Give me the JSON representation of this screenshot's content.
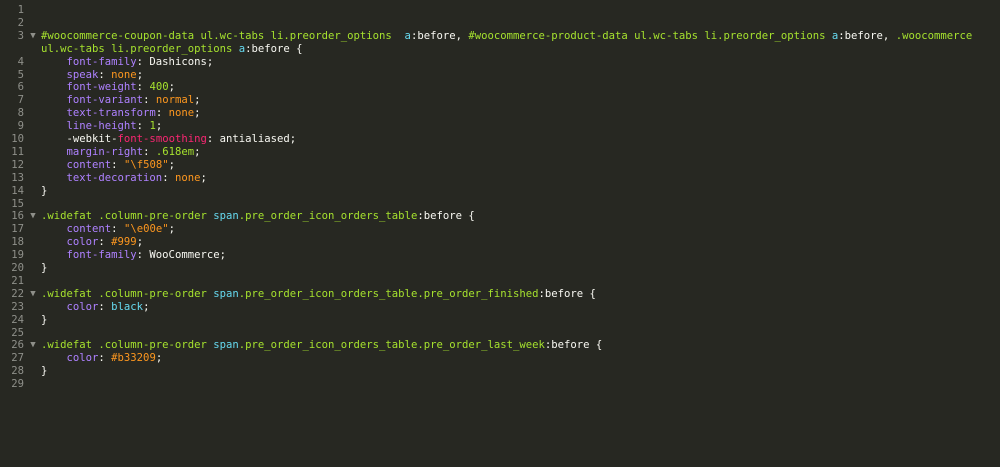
{
  "editor": {
    "language": "css",
    "colors": {
      "background": "#272822",
      "gutter_text": "#8f908a",
      "selector": "#a6e22e",
      "property": "#66d9ef",
      "value": "#e6db74",
      "number": "#ae81ff",
      "keyword": "#fd971f",
      "accent": "#f92672"
    },
    "lines": [
      {
        "n": "1",
        "fold": "",
        "tokens": []
      },
      {
        "n": "2",
        "fold": "",
        "tokens": []
      },
      {
        "n": "3",
        "fold": "▼",
        "tokens": [
          {
            "t": "#woocommerce-coupon-data ul.wc-tabs li.preorder_options  ",
            "c": "green"
          },
          {
            "t": "a",
            "c": "blue"
          },
          {
            "t": ":before, ",
            "c": "white"
          },
          {
            "t": "#woocommerce-product-data ul.wc-tabs li.preorder_options ",
            "c": "green"
          },
          {
            "t": "a",
            "c": "blue"
          },
          {
            "t": ":before, ",
            "c": "white"
          },
          {
            "t": ".woocommerce",
            "c": "green"
          }
        ]
      },
      {
        "n": "",
        "fold": "",
        "tokens": [
          {
            "t": "ul.wc-tabs li.preorder_options ",
            "c": "green"
          },
          {
            "t": "a",
            "c": "blue"
          },
          {
            "t": ":before {",
            "c": "white"
          }
        ]
      },
      {
        "n": "4",
        "fold": "",
        "tokens": [
          {
            "t": "    font-family",
            "c": "purple"
          },
          {
            "t": ": Dashicons;",
            "c": "white"
          }
        ]
      },
      {
        "n": "5",
        "fold": "",
        "tokens": [
          {
            "t": "    speak",
            "c": "purple"
          },
          {
            "t": ": ",
            "c": "white"
          },
          {
            "t": "none",
            "c": "orange"
          },
          {
            "t": ";",
            "c": "white"
          }
        ]
      },
      {
        "n": "6",
        "fold": "",
        "tokens": [
          {
            "t": "    font-weight",
            "c": "purple"
          },
          {
            "t": ": ",
            "c": "white"
          },
          {
            "t": "400",
            "c": "green"
          },
          {
            "t": ";",
            "c": "white"
          }
        ]
      },
      {
        "n": "7",
        "fold": "",
        "tokens": [
          {
            "t": "    font-variant",
            "c": "purple"
          },
          {
            "t": ": ",
            "c": "white"
          },
          {
            "t": "normal",
            "c": "orange"
          },
          {
            "t": ";",
            "c": "white"
          }
        ]
      },
      {
        "n": "8",
        "fold": "",
        "tokens": [
          {
            "t": "    text-transform",
            "c": "purple"
          },
          {
            "t": ": ",
            "c": "white"
          },
          {
            "t": "none",
            "c": "orange"
          },
          {
            "t": ";",
            "c": "white"
          }
        ]
      },
      {
        "n": "9",
        "fold": "",
        "tokens": [
          {
            "t": "    line-height",
            "c": "purple"
          },
          {
            "t": ": ",
            "c": "white"
          },
          {
            "t": "1",
            "c": "green"
          },
          {
            "t": ";",
            "c": "white"
          }
        ]
      },
      {
        "n": "10",
        "fold": "",
        "tokens": [
          {
            "t": "    -webkit-",
            "c": "white"
          },
          {
            "t": "font-smoothing",
            "c": "red"
          },
          {
            "t": ": antialiased;",
            "c": "white"
          }
        ]
      },
      {
        "n": "11",
        "fold": "",
        "tokens": [
          {
            "t": "    margin-right",
            "c": "purple"
          },
          {
            "t": ": ",
            "c": "white"
          },
          {
            "t": ".618em",
            "c": "green"
          },
          {
            "t": ";",
            "c": "white"
          }
        ]
      },
      {
        "n": "12",
        "fold": "",
        "tokens": [
          {
            "t": "    content",
            "c": "purple"
          },
          {
            "t": ": ",
            "c": "white"
          },
          {
            "t": "\"\\f508\"",
            "c": "orange"
          },
          {
            "t": ";",
            "c": "white"
          }
        ]
      },
      {
        "n": "13",
        "fold": "",
        "tokens": [
          {
            "t": "    text-decoration",
            "c": "purple"
          },
          {
            "t": ": ",
            "c": "white"
          },
          {
            "t": "none",
            "c": "orange"
          },
          {
            "t": ";",
            "c": "white"
          }
        ]
      },
      {
        "n": "14",
        "fold": "",
        "tokens": [
          {
            "t": "}",
            "c": "white"
          }
        ]
      },
      {
        "n": "15",
        "fold": "",
        "tokens": []
      },
      {
        "n": "16",
        "fold": "▼",
        "tokens": [
          {
            "t": ".widefat .column-pre-order ",
            "c": "green"
          },
          {
            "t": "span",
            "c": "blue"
          },
          {
            "t": ".pre_order_icon_orders_table",
            "c": "green"
          },
          {
            "t": ":before {",
            "c": "white"
          }
        ]
      },
      {
        "n": "17",
        "fold": "",
        "tokens": [
          {
            "t": "    content",
            "c": "purple"
          },
          {
            "t": ": ",
            "c": "white"
          },
          {
            "t": "\"\\e00e\"",
            "c": "orange"
          },
          {
            "t": ";",
            "c": "white"
          }
        ]
      },
      {
        "n": "18",
        "fold": "",
        "tokens": [
          {
            "t": "    color",
            "c": "purple"
          },
          {
            "t": ": ",
            "c": "white"
          },
          {
            "t": "#999",
            "c": "orange"
          },
          {
            "t": ";",
            "c": "white"
          }
        ]
      },
      {
        "n": "19",
        "fold": "",
        "tokens": [
          {
            "t": "    font-family",
            "c": "purple"
          },
          {
            "t": ": WooCommerce;",
            "c": "white"
          }
        ]
      },
      {
        "n": "20",
        "fold": "",
        "tokens": [
          {
            "t": "}",
            "c": "white"
          }
        ]
      },
      {
        "n": "21",
        "fold": "",
        "tokens": []
      },
      {
        "n": "22",
        "fold": "▼",
        "tokens": [
          {
            "t": ".widefat .column-pre-order ",
            "c": "green"
          },
          {
            "t": "span",
            "c": "blue"
          },
          {
            "t": ".pre_order_icon_orders_table.pre_order_finished",
            "c": "green"
          },
          {
            "t": ":before {",
            "c": "white"
          }
        ]
      },
      {
        "n": "23",
        "fold": "",
        "tokens": [
          {
            "t": "    color",
            "c": "purple"
          },
          {
            "t": ": ",
            "c": "white"
          },
          {
            "t": "black",
            "c": "blue"
          },
          {
            "t": ";",
            "c": "white"
          }
        ]
      },
      {
        "n": "24",
        "fold": "",
        "tokens": [
          {
            "t": "}",
            "c": "white"
          }
        ]
      },
      {
        "n": "25",
        "fold": "",
        "tokens": []
      },
      {
        "n": "26",
        "fold": "▼",
        "tokens": [
          {
            "t": ".widefat .column-pre-order ",
            "c": "green"
          },
          {
            "t": "span",
            "c": "blue"
          },
          {
            "t": ".pre_order_icon_orders_table.pre_order_last_week",
            "c": "green"
          },
          {
            "t": ":before {",
            "c": "white"
          }
        ]
      },
      {
        "n": "27",
        "fold": "",
        "tokens": [
          {
            "t": "    color",
            "c": "purple"
          },
          {
            "t": ": ",
            "c": "white"
          },
          {
            "t": "#b33209",
            "c": "orange"
          },
          {
            "t": ";",
            "c": "white"
          }
        ]
      },
      {
        "n": "28",
        "fold": "",
        "tokens": [
          {
            "t": "}",
            "c": "white"
          }
        ]
      },
      {
        "n": "29",
        "fold": "",
        "tokens": []
      }
    ]
  }
}
